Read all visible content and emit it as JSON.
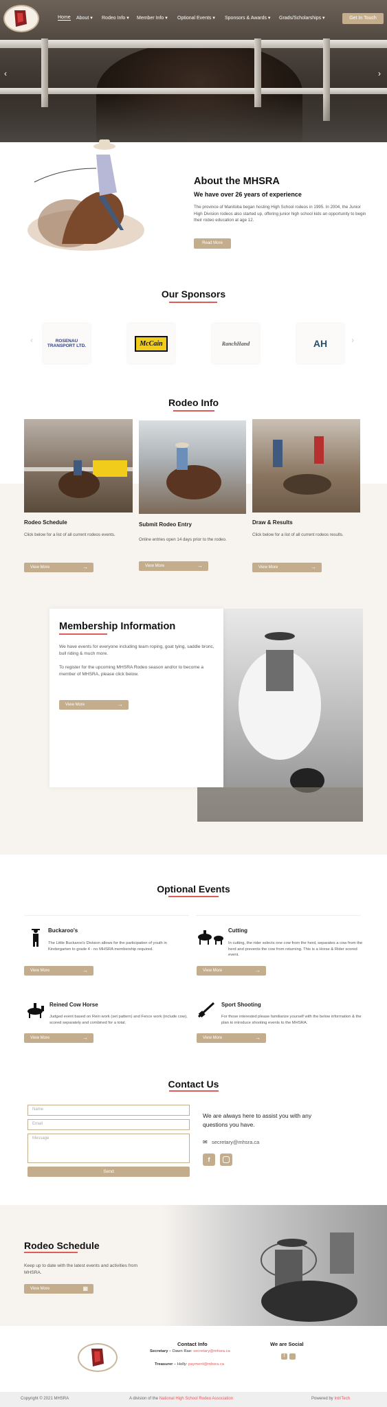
{
  "nav": {
    "items": [
      "Home",
      "About",
      "Rodeo Info",
      "Member Info",
      "Optional Events",
      "Sponsors & Awards",
      "Grads/Scholarships"
    ],
    "cta": "Get In Touch"
  },
  "about": {
    "title": "About the MHSRA",
    "subtitle": "We have over 26 years of experience",
    "text": "The province of Manitoba began hosting High School rodeos in 1995. In 2004, the Junior High Division rodeos also started up, offering junior high school kids an opportunity to begin their rodeo education at age 12.",
    "button": "Read More"
  },
  "sponsors": {
    "title": "Our Sponsors",
    "items": [
      "ROSENAU TRANSPORT LTD.",
      "McCain",
      "RanchHand",
      "AH"
    ]
  },
  "rodeo_info": {
    "title": "Rodeo Info",
    "cards": [
      {
        "title": "Rodeo Schedule",
        "text": "Click below for a list of all current rodeos events.",
        "button": "View More"
      },
      {
        "title": "Submit Rodeo Entry",
        "text": "Online entries open 14 days prior to the rodeo.",
        "button": "View More"
      },
      {
        "title": "Draw & Results",
        "text": "Click below for a list of all current rodeos results.",
        "button": "View More"
      }
    ]
  },
  "membership": {
    "title": "Membership Information",
    "text1": "We have events for everyone including team roping, goat tying, saddle bronc, bull riding & much more.",
    "text2": "To register for the upcoming  MHSRA Rodeo season and/or to become a member of MHSRA, please click below.",
    "button": "View More"
  },
  "optional_events": {
    "title": "Optional Events",
    "items": [
      {
        "title": "Buckaroo's",
        "text": "The Little Buckaroo's Division allows for the participation of youth in Kindergarten to grade 4 - no MHSRA membership required.",
        "button": "View More",
        "icon": "cowboy-kid-icon"
      },
      {
        "title": "Cutting",
        "text": "In cutting, the rider selects one cow from the herd, separates a cow from the herd and prevents the cow from returning. This is a Horse & Rider scored event.",
        "button": "View More",
        "icon": "horse-cow-icon"
      },
      {
        "title": "Reined Cow Horse",
        "text": "Judged event based on Rein work (set pattern) and Fence work (include cow), scored separately and combined for a total.",
        "button": "View More",
        "icon": "horse-rider-icon"
      },
      {
        "title": "Sport Shooting",
        "text": "For those interested please familiarize yourself with the below information & the plan to introduce shooting events to the MHSRA.",
        "button": "View More",
        "icon": "rifle-icon"
      }
    ]
  },
  "contact": {
    "title": "Contact Us",
    "name_placeholder": "Name",
    "email_placeholder": "Email",
    "message_placeholder": "Message",
    "send": "Send",
    "tagline": "We are always here to assist you with any questions you have.",
    "email": "secretary@mhsra.ca"
  },
  "schedule_banner": {
    "title": "Rodeo Schedule",
    "text": "Keep up to date with the latest events and activities from MHSRA.",
    "button": "View More"
  },
  "footer": {
    "contact_title": "Contact Info",
    "secretary_label": "Secretary",
    "secretary_name": " – Dawn Rae: ",
    "secretary_email": "secretary@mhsra.ca",
    "treasurer_label": "Treasurer",
    "treasurer_name": " – Holly: ",
    "treasurer_email": "payment@mhsra.ca",
    "social_title": "We are Social",
    "copyright": "Copyright © 2021 MHSRA",
    "division_prefix": "A division of the ",
    "division_link": "National High School Rodeo Association",
    "powered_prefix": "Powered by ",
    "powered_link": "IntriTech"
  },
  "colors": {
    "accent": "#c4ad8d",
    "red": "#e05a5a",
    "beige": "#f7f3ee"
  }
}
